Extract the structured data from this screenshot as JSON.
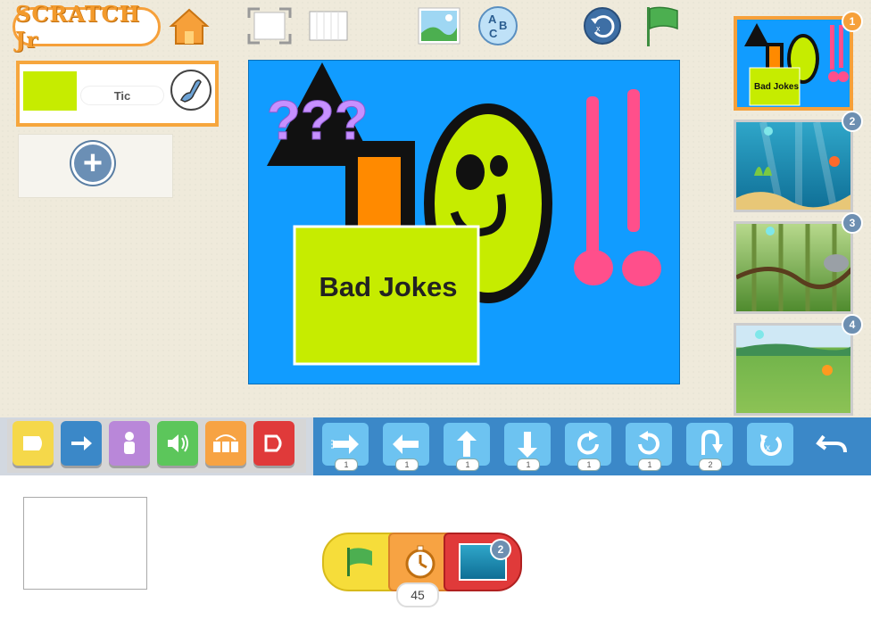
{
  "app": {
    "logo_text": "SCRATCH Jr"
  },
  "toolbar": {
    "home": "home-icon",
    "fullscreen": "fullscreen-icon",
    "grid": "grid-icon",
    "background": "background-icon",
    "text": "text-abc-icon",
    "reset": "reset-characters-icon",
    "green_flag": "green-flag-icon"
  },
  "sprites": {
    "items": [
      {
        "name": "Tic",
        "color": "#c6ec00"
      }
    ],
    "paint": "paintbrush-icon",
    "add": "add-icon"
  },
  "stage": {
    "title_text": "Bad Jokes",
    "question_marks": "???",
    "colors": {
      "background": "#119cff",
      "yellow_green": "#c6ec00",
      "orange": "#ff8a00",
      "purple": "#c790ff",
      "pink": "#ff4f8b"
    }
  },
  "pages": [
    {
      "number": "1",
      "label": "Bad Jokes",
      "selected": true
    },
    {
      "number": "2",
      "label": "underwater"
    },
    {
      "number": "3",
      "label": "jungle"
    },
    {
      "number": "4",
      "label": "farm"
    }
  ],
  "categories": [
    {
      "name": "triggering",
      "color": "#f5d84a"
    },
    {
      "name": "motion",
      "color": "#3b88c8"
    },
    {
      "name": "looks",
      "color": "#b987d9"
    },
    {
      "name": "sound",
      "color": "#5cc65b"
    },
    {
      "name": "control",
      "color": "#f7a343"
    },
    {
      "name": "end",
      "color": "#e03a3a"
    }
  ],
  "motion_blocks": [
    {
      "name": "move-right",
      "num": "1"
    },
    {
      "name": "move-left",
      "num": "1"
    },
    {
      "name": "move-up",
      "num": "1"
    },
    {
      "name": "move-down",
      "num": "1"
    },
    {
      "name": "turn-right",
      "num": "1"
    },
    {
      "name": "turn-left",
      "num": "1"
    },
    {
      "name": "hop",
      "num": "2"
    },
    {
      "name": "go-home",
      "num": ""
    }
  ],
  "undo": "undo-icon",
  "script": {
    "blocks": [
      {
        "name": "start-on-green-flag"
      },
      {
        "name": "wait",
        "value": "45"
      },
      {
        "name": "go-to-page",
        "value": "2"
      }
    ]
  }
}
